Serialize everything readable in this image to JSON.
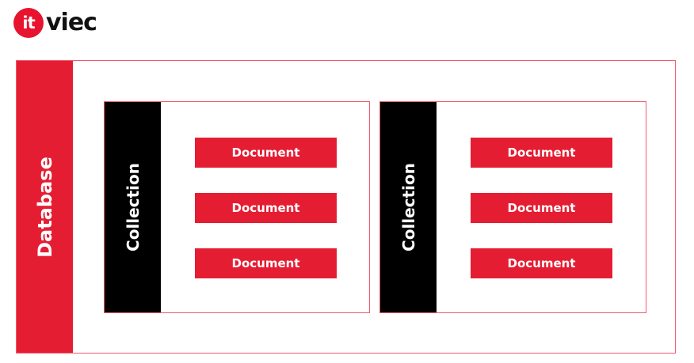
{
  "logo": {
    "badge_text": "it",
    "text": "viec"
  },
  "database": {
    "label": "Database",
    "collections": [
      {
        "label": "Collection",
        "documents": [
          "Document",
          "Document",
          "Document"
        ]
      },
      {
        "label": "Collection",
        "documents": [
          "Document",
          "Document",
          "Document"
        ]
      }
    ]
  },
  "colors": {
    "brand_red": "#e51d32",
    "collection_black": "#000000",
    "border_pink": "#f05a6c"
  }
}
